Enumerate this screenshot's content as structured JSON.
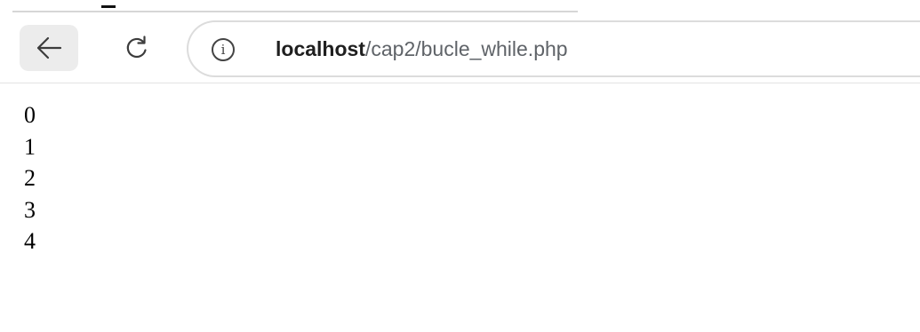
{
  "address_bar": {
    "url_host": "localhost",
    "url_path": "/cap2/bucle_while.php"
  },
  "icons": {
    "back": "back-arrow-icon",
    "reload": "reload-icon",
    "info": "info-icon"
  },
  "page": {
    "lines": [
      "0",
      "1",
      "2",
      "3",
      "4"
    ]
  },
  "colors": {
    "back_button_bg": "#ececec",
    "url_path": "#5f6368"
  }
}
